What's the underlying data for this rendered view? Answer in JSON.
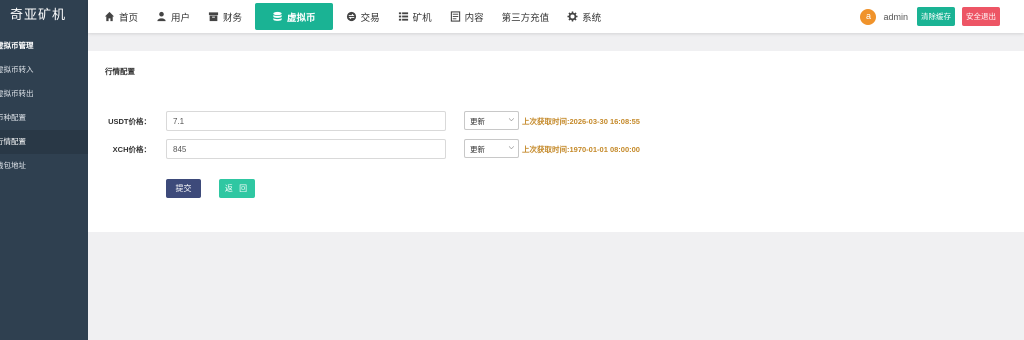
{
  "sidebar": {
    "brand": "奇亚矿机",
    "group_title": "虚拟币管理",
    "items": [
      {
        "label": "虚拟币转入"
      },
      {
        "label": "虚拟币转出"
      },
      {
        "label": "币种配置"
      },
      {
        "label": "行情配置"
      },
      {
        "label": "钱包地址"
      }
    ]
  },
  "topnav": {
    "items": [
      {
        "label": "首页",
        "icon": "home-icon"
      },
      {
        "label": "用户",
        "icon": "user-icon"
      },
      {
        "label": "财务",
        "icon": "archive-icon"
      },
      {
        "label": "虚拟币",
        "icon": "database-icon"
      },
      {
        "label": "交易",
        "icon": "exchange-icon"
      },
      {
        "label": "矿机",
        "icon": "list-icon"
      },
      {
        "label": "内容",
        "icon": "document-icon"
      },
      {
        "label": "第三方充值",
        "icon": ""
      },
      {
        "label": "系统",
        "icon": "gear-icon"
      }
    ],
    "active_index": 3
  },
  "user": {
    "avatar_letter": "a",
    "name": "admin",
    "clear_cache_label": "清除缓存",
    "logout_label": "安全退出"
  },
  "panel": {
    "title": "行情配置",
    "rows": [
      {
        "label": "USDT价格：",
        "value": "7.1",
        "select": "更新",
        "info": "上次获取时间:2026-03-30 16:08:55"
      },
      {
        "label": "XCH价格：",
        "value": "845",
        "select": "更新",
        "info": "上次获取时间:1970-01-01 08:00:00"
      }
    ],
    "submit_label": "提交",
    "back_label": "返 回"
  },
  "colors": {
    "sidebar_bg": "#2f4050",
    "accent": "#1ab394",
    "danger": "#ed5565",
    "submit": "#3d4a7a",
    "info_text": "#c58a2a"
  }
}
